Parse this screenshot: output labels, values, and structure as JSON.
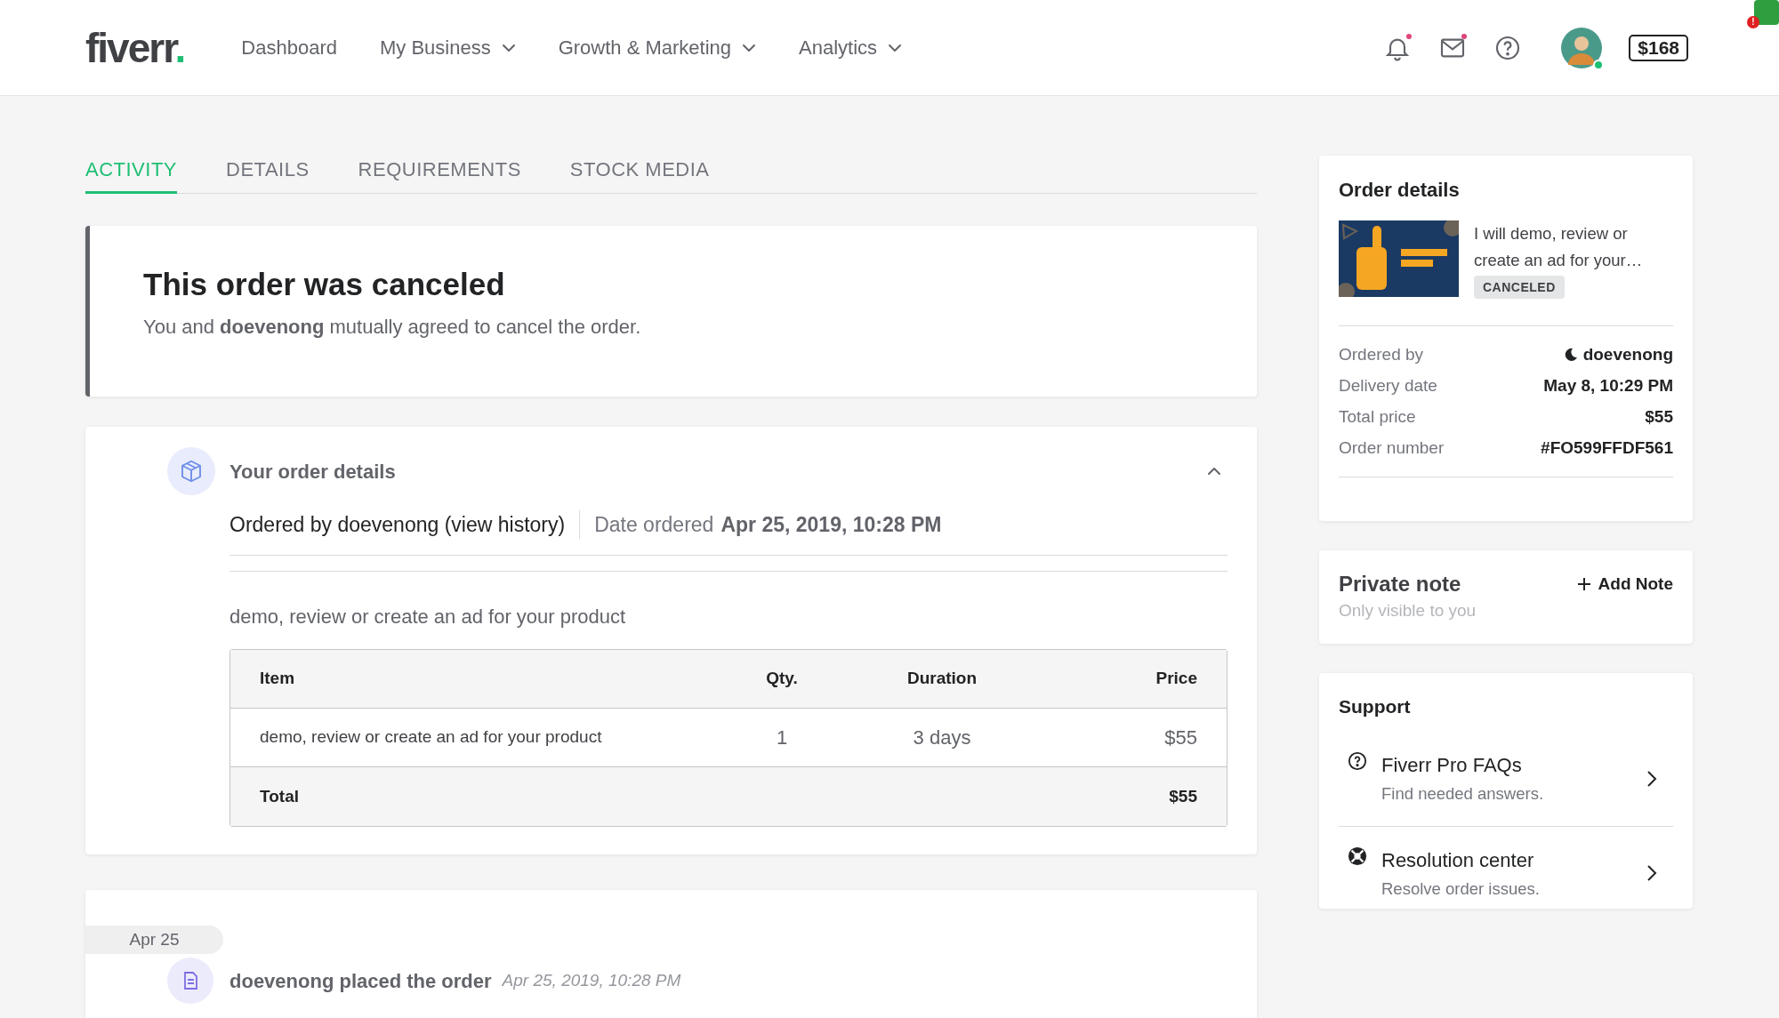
{
  "header": {
    "logo": "fiverr",
    "logo_dot": ".",
    "nav": [
      {
        "label": "Dashboard",
        "dropdown": false
      },
      {
        "label": "My Business",
        "dropdown": true
      },
      {
        "label": "Growth & Marketing",
        "dropdown": true
      },
      {
        "label": "Analytics",
        "dropdown": true
      }
    ],
    "notifications_unread": true,
    "messages_unread": true,
    "online": true,
    "balance": "$168",
    "extension_badge": "!"
  },
  "tabs": [
    {
      "label": "ACTIVITY",
      "selected": true
    },
    {
      "label": "DETAILS",
      "selected": false
    },
    {
      "label": "REQUIREMENTS",
      "selected": false
    },
    {
      "label": "STOCK MEDIA",
      "selected": false
    }
  ],
  "notice": {
    "title": "This order was canceled",
    "message": "You and **doevenong** mutually agreed to cancel the order."
  },
  "order_summary": {
    "title": "Your order details",
    "expanded": true,
    "ordered_by": "Ordered by doevenong (view history)",
    "date_label": "Date ordered",
    "date": "Apr 25, 2019, 10:28 PM",
    "description": "demo, review or create an ad for your product",
    "table": {
      "columns": [
        "Item",
        "Qty.",
        "Duration",
        "Price"
      ],
      "rows": [
        [
          "demo, review or create an ad for your product",
          "1",
          "3 days",
          "$55"
        ]
      ],
      "total": {
        "label": "Total",
        "value": "$55"
      }
    }
  },
  "timeline": {
    "date_chip": "Apr 25",
    "event": "doevenong placed the order",
    "time": "Apr 25, 2019, 10:28 PM"
  },
  "sidebar": {
    "order_details": {
      "title": "Order details",
      "gig_title": "I will demo, review or create an ad for your…",
      "status": "CANCELED",
      "fields": [
        {
          "label": "Ordered by",
          "value": "doevenong",
          "kind": "user"
        },
        {
          "label": "Delivery date",
          "value": "May 8, 10:29 PM",
          "kind": "text"
        },
        {
          "label": "Total price",
          "value": "$55",
          "kind": "text"
        },
        {
          "label": "Order number",
          "value": "#FO599FFDF561",
          "kind": "text"
        }
      ]
    },
    "private_note": {
      "title": "Private note",
      "subtitle": "Only visible to you",
      "action": "Add Note"
    },
    "support": {
      "title": "Support",
      "items": [
        {
          "kind": "faq",
          "title": "Fiverr Pro FAQs",
          "subtitle": "Find needed answers."
        },
        {
          "kind": "resolution",
          "title": "Resolution center",
          "subtitle": "Resolve order issues."
        }
      ]
    }
  }
}
